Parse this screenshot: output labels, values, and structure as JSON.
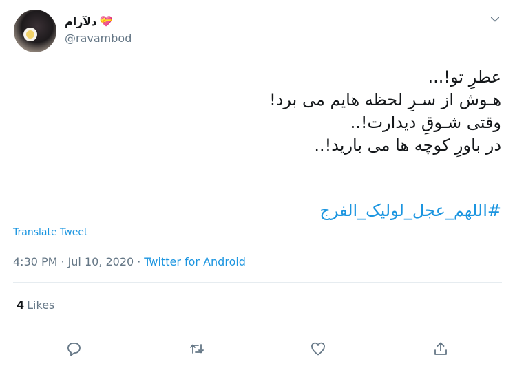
{
  "user": {
    "display_name": "دلآرام",
    "handle": "@ravambod",
    "name_badge_emoji": "💝"
  },
  "tweet": {
    "lines": [
      "عطرِ تو!...",
      "هـوش از سـرِ لحظه هایم می برد!",
      "وقتی شـوقِ دیدارت!..",
      "در باورِ کوچه ها می بارید!.."
    ],
    "hashtag": "#اللهم_عجل_لولیک_الفرج",
    "translate_label": "Translate Tweet"
  },
  "meta": {
    "time": "4:30 PM",
    "separator": "·",
    "date": "Jul 10, 2020",
    "source": "Twitter for Android"
  },
  "stats": {
    "likes_count": "4",
    "likes_label": "Likes"
  },
  "icons": {
    "caret": "chevron-down-icon",
    "reply": "reply-icon",
    "retweet": "retweet-icon",
    "like": "heart-icon",
    "share": "share-icon"
  },
  "colors": {
    "accent": "#1b95e0",
    "muted": "#657786",
    "text": "#14171a",
    "divider": "#e6ecf0"
  }
}
